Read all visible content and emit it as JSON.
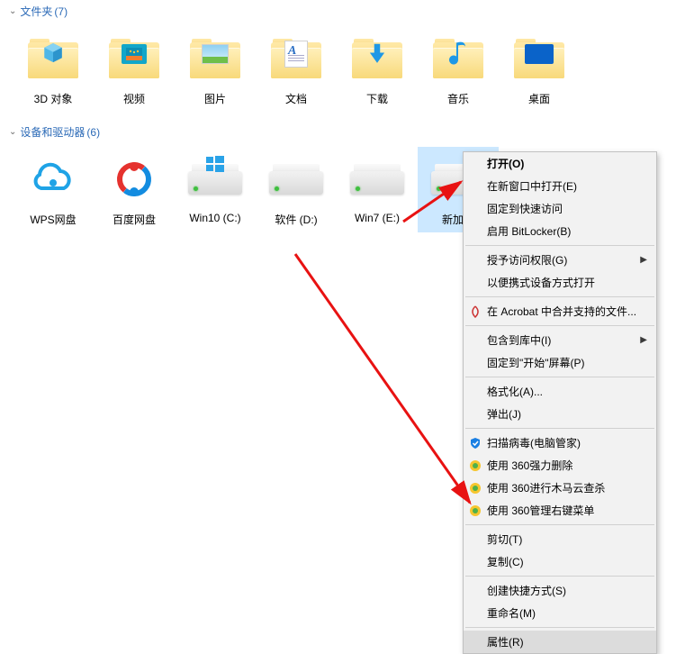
{
  "sections": {
    "folders": {
      "title": "文件夹",
      "count": "(7)",
      "items": [
        {
          "label": "3D 对象"
        },
        {
          "label": "视频"
        },
        {
          "label": "图片"
        },
        {
          "label": "文档"
        },
        {
          "label": "下载"
        },
        {
          "label": "音乐"
        },
        {
          "label": "桌面"
        }
      ]
    },
    "drives": {
      "title": "设备和驱动器",
      "count": "(6)",
      "items": [
        {
          "label": "WPS网盘"
        },
        {
          "label": "百度网盘"
        },
        {
          "label": "Win10 (C:)"
        },
        {
          "label": "软件 (D:)"
        },
        {
          "label": "Win7 (E:)"
        },
        {
          "label": "新加卷"
        }
      ]
    }
  },
  "menu": {
    "open": "打开(O)",
    "open_new_window": "在新窗口中打开(E)",
    "pin_quick": "固定到快速访问",
    "bitlocker": "启用 BitLocker(B)",
    "grant_access": "授予访问权限(G)",
    "open_portable": "以便携式设备方式打开",
    "acrobat": "在 Acrobat 中合并支持的文件...",
    "include_lib": "包含到库中(I)",
    "pin_start": "固定到\"开始\"屏幕(P)",
    "format": "格式化(A)...",
    "eject": "弹出(J)",
    "scan_virus": "扫描病毒(电脑管家)",
    "a360_delete": "使用 360强力删除",
    "a360_trojan": "使用 360进行木马云查杀",
    "a360_menu": "使用 360管理右键菜单",
    "cut": "剪切(T)",
    "copy": "复制(C)",
    "shortcut": "创建快捷方式(S)",
    "rename": "重命名(M)",
    "properties": "属性(R)"
  }
}
